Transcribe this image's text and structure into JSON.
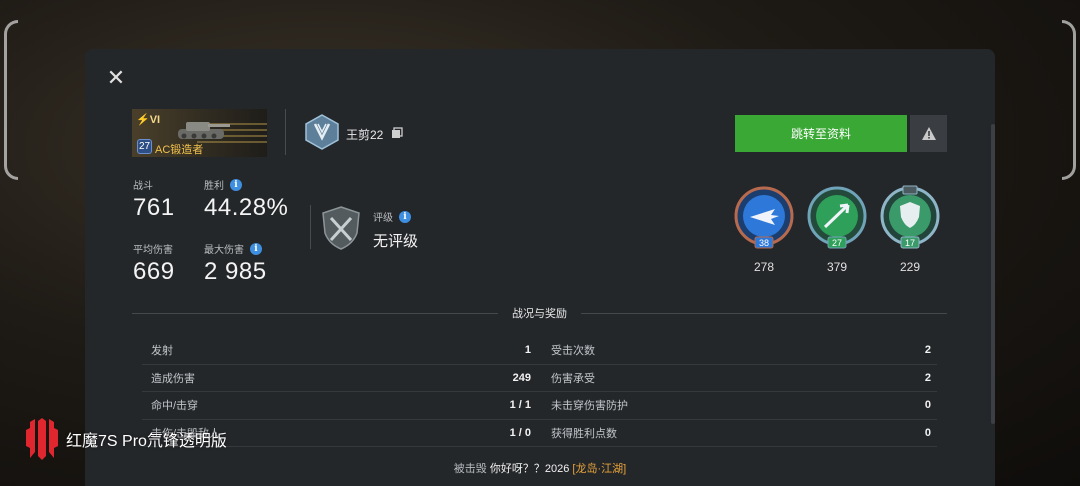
{
  "tank": {
    "tier": "VI",
    "level": "27",
    "name": "AC锻造者"
  },
  "player": {
    "name": "王剪22"
  },
  "actions": {
    "goto_profile": "跳转至资料"
  },
  "stats": {
    "battles": {
      "label": "战斗",
      "value": "761"
    },
    "winrate": {
      "label": "胜利",
      "value": "44.28%"
    },
    "avg_damage": {
      "label": "平均伤害",
      "value": "669"
    },
    "max_damage": {
      "label": "最大伤害",
      "value": "2 985"
    }
  },
  "rating": {
    "label": "评级",
    "value": "无评级"
  },
  "medals": [
    {
      "level": "38",
      "count": "278",
      "color": "#2d78d8"
    },
    {
      "level": "27",
      "count": "379",
      "color": "#2fa05a"
    },
    {
      "level": "17",
      "count": "229",
      "color": "#3a9a6a"
    }
  ],
  "section": {
    "title": "战况与奖励"
  },
  "table": [
    [
      {
        "k": "发射",
        "v": "1"
      },
      {
        "k": "受击次数",
        "v": "2"
      }
    ],
    [
      {
        "k": "造成伤害",
        "v": "249"
      },
      {
        "k": "伤害承受",
        "v": "2"
      }
    ],
    [
      {
        "k": "命中/击穿",
        "v": "1 / 1"
      },
      {
        "k": "未击穿伤害防护",
        "v": "0"
      }
    ],
    [
      {
        "k": "击伤/击毁敌人",
        "v": "1 / 0"
      },
      {
        "k": "获得胜利点数",
        "v": "0"
      }
    ]
  ],
  "footer": {
    "prefix": "被击毁",
    "player": "你好呀？？2026",
    "clan": "[龙岛·江湖]"
  },
  "watermark": {
    "text": "红魔7S Pro氘锋透明版"
  }
}
